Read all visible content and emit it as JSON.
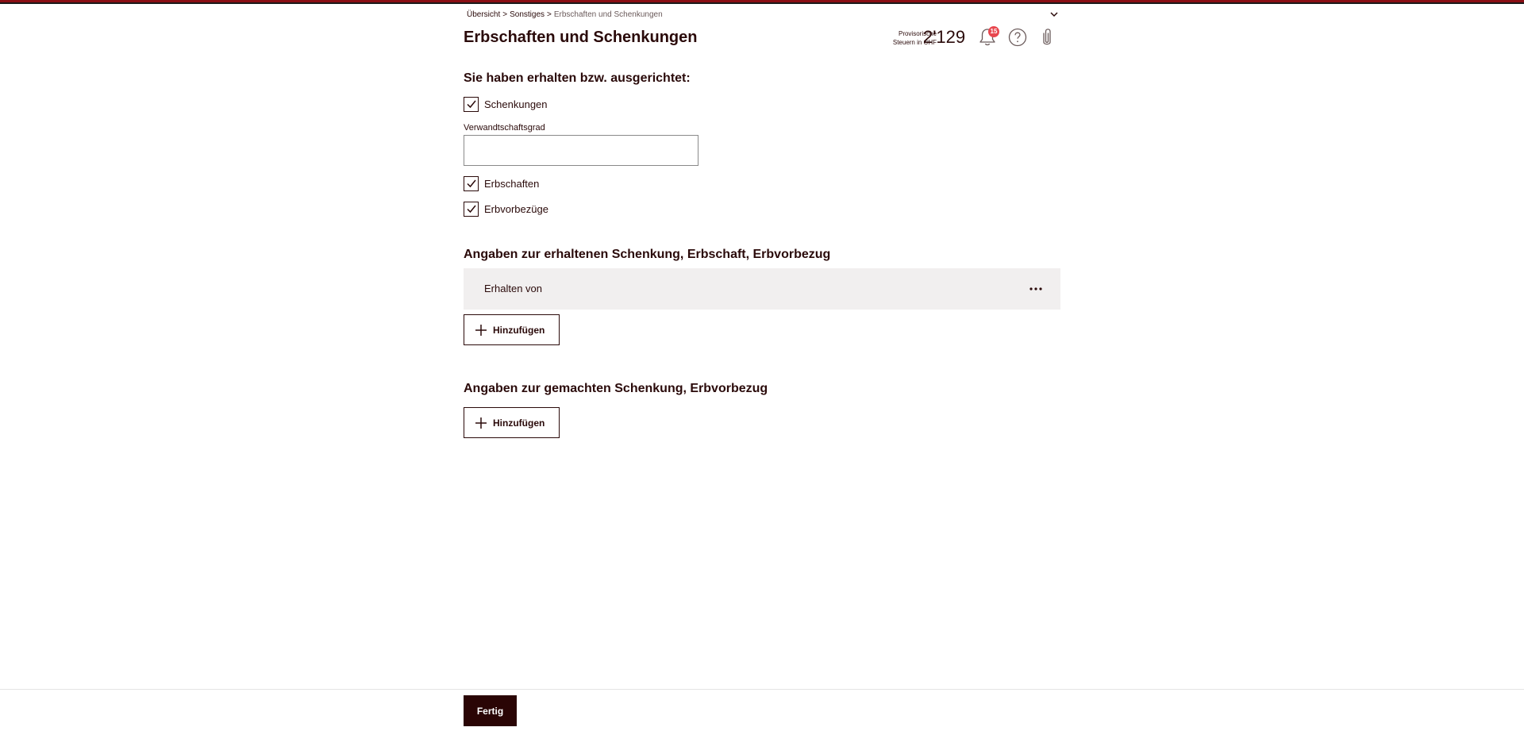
{
  "breadcrumb": {
    "items": [
      "Übersicht",
      "Sonstiges",
      "Erbschaften und Schenkungen"
    ],
    "separator": ">"
  },
  "header": {
    "title": "Erbschaften und Schenkungen",
    "tax_label_line1": "Provisorische",
    "tax_label_line2": "Steuern in CHF",
    "tax_value": "2'129",
    "notification_count": "15"
  },
  "received_section": {
    "heading": "Sie haben erhalten bzw. ausgerichtet:",
    "checkboxes": [
      {
        "label": "Schenkungen",
        "checked": true
      },
      {
        "label": "Erbschaften",
        "checked": true
      },
      {
        "label": "Erbvorbezüge",
        "checked": true
      }
    ],
    "relationship_field": {
      "label": "Verwandtschaftsgrad",
      "value": "",
      "placeholder": ""
    }
  },
  "received_details": {
    "heading": "Angaben zur erhaltenen Schenkung, Erbschaft, Erbvorbezug",
    "row_label": "Erhalten von",
    "add_label": "Hinzufügen"
  },
  "made_details": {
    "heading": "Angaben zur gemachten Schenkung, Erbvorbezug",
    "add_label": "Hinzufügen"
  },
  "footer": {
    "done_label": "Fertig"
  },
  "colors": {
    "brand_red": "#8a0f14",
    "text_dark": "#2a0a0a",
    "badge_red": "#e8474f",
    "row_bg": "#f1efef",
    "done_bg": "#2a0505"
  },
  "icons": {
    "collapse": "chevron-down-icon",
    "notifications": "bell-icon",
    "help": "help-icon",
    "attachments": "paperclip-icon",
    "checkbox": "checkmark-icon",
    "more": "more-icon",
    "add": "plus-icon"
  }
}
